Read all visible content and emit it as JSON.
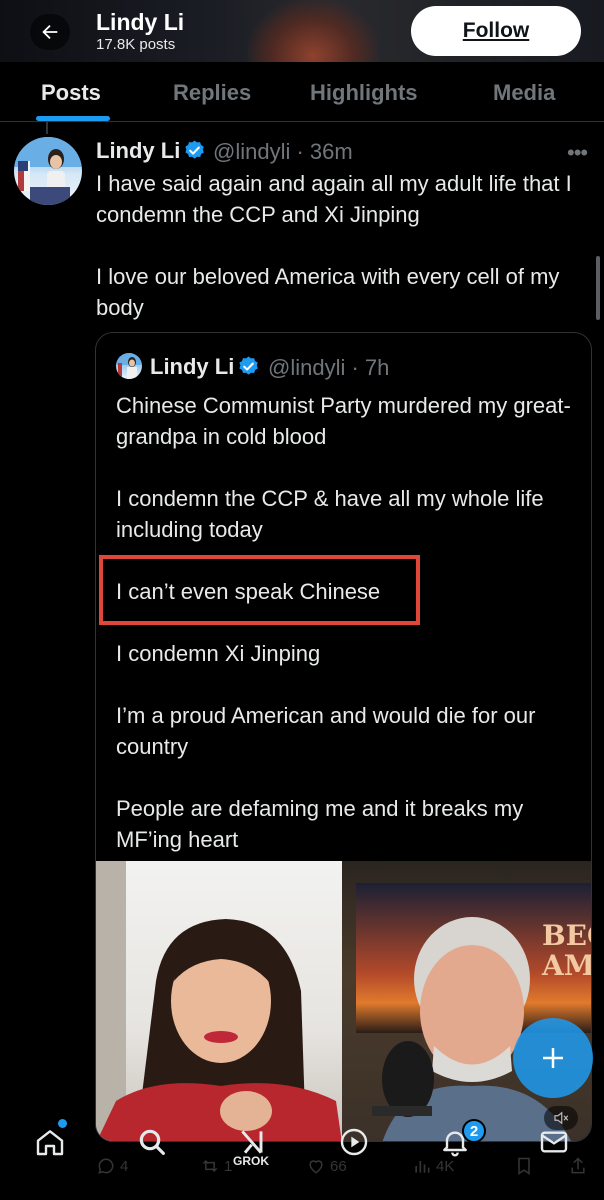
{
  "header": {
    "name": "Lindy Li",
    "post_count": "17.8K posts",
    "follow_label": "Follow",
    "back_icon": "arrow-left-icon"
  },
  "tabs": [
    {
      "label": "Posts",
      "active": true
    },
    {
      "label": "Replies",
      "active": false
    },
    {
      "label": "Highlights",
      "active": false
    },
    {
      "label": "Media",
      "active": false
    }
  ],
  "post": {
    "author": "Lindy Li",
    "handle_time": "@lindyli · 36m",
    "paragraphs": [
      "I have said again and again all my adult life that I condemn the CCP and Xi Jinping",
      "I love our beloved America with every cell of my body"
    ]
  },
  "quote": {
    "author": "Lindy Li",
    "handle_time": "@lindyli · 7h",
    "paragraphs": [
      "Chinese Communist Party murdered my great-grandpa in cold blood",
      "I condemn the CCP & have all my whole life including today",
      "I can’t even speak Chinese",
      "I condemn Xi Jinping",
      "I’m a proud American and would die for our country",
      "People are defaming me and it breaks my MF’ing heart"
    ],
    "video_overlay_text": "BECK\nAM"
  },
  "actions": {
    "replies": "4",
    "reposts": "1",
    "likes": "66",
    "views": "4K"
  },
  "nav": {
    "grok_label": "GROK",
    "notif_count": "2"
  },
  "colors": {
    "accent": "#1d9bf0",
    "highlight_box": "#e0473b",
    "background": "#000000"
  }
}
